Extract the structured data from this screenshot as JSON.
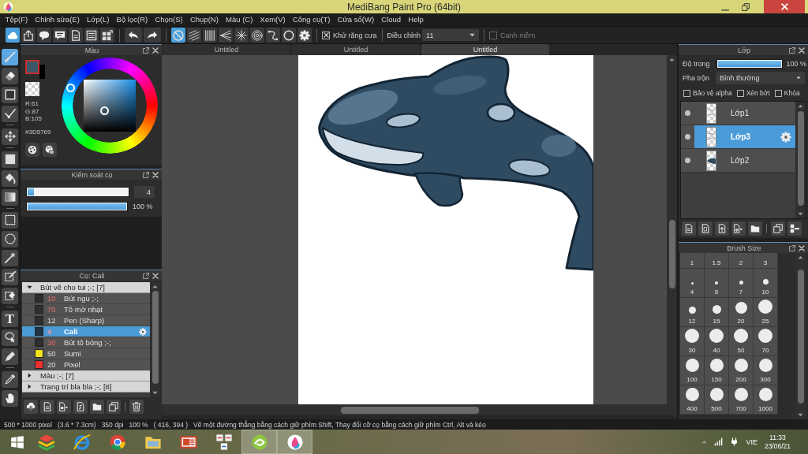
{
  "window": {
    "title": "MediBang Paint Pro (64bit)"
  },
  "menu": [
    "Tệp(F)",
    "Chỉnh sửa(E)",
    "Lớp(L)",
    "Bộ lọc(R)",
    "Chọn(S)",
    "Chụp(N)",
    "Màu (C)",
    "Xem(V)",
    "Công cụ(T)",
    "Cửa sổ(W)",
    "Cloud",
    "Help"
  ],
  "toolbar": {
    "groups": [
      {
        "buttons": [
          {
            "kind": "cloud",
            "selected": true
          },
          {
            "kind": "share",
            "selected": false
          },
          {
            "kind": "bubble",
            "selected": false
          },
          {
            "kind": "comment",
            "selected": false
          },
          {
            "kind": "document",
            "selected": false
          },
          {
            "kind": "list-document",
            "selected": false
          },
          {
            "kind": "grid-document",
            "selected": false
          }
        ]
      },
      {
        "buttons": [
          {
            "kind": "undo",
            "selected": false
          },
          {
            "kind": "redo",
            "selected": false
          }
        ]
      },
      {
        "buttons": [
          {
            "kind": "no-snap",
            "selected": true
          },
          {
            "kind": "parallel",
            "selected": false
          },
          {
            "kind": "vertical",
            "selected": false
          },
          {
            "kind": "fan",
            "selected": false
          },
          {
            "kind": "radial",
            "selected": false
          },
          {
            "kind": "concentric",
            "selected": false
          },
          {
            "kind": "curve",
            "selected": false
          },
          {
            "kind": "circle",
            "selected": false
          },
          {
            "kind": "gear",
            "selected": false
          }
        ]
      }
    ],
    "antialias": {
      "label": "Khử răng cưa",
      "checked": true,
      "disabled": false
    },
    "adjust": {
      "label": "Điều chỉnh",
      "value": "11"
    },
    "smooth_edge": {
      "label": "Canh mềm",
      "checked": false,
      "disabled": true
    }
  },
  "tools": {
    "groups": [
      {
        "tools": [
          {
            "kind": "brush",
            "selected": true
          },
          {
            "kind": "eraser",
            "selected": false
          },
          {
            "kind": "shape",
            "selected": false
          },
          {
            "kind": "vector",
            "selected": false
          }
        ]
      },
      {
        "tools": [
          {
            "kind": "move",
            "selected": false
          }
        ]
      },
      {
        "tools": [
          {
            "kind": "fill",
            "selected": false
          },
          {
            "kind": "bucket",
            "selected": false
          },
          {
            "kind": "gradient",
            "selected": false
          }
        ]
      },
      {
        "tools": [
          {
            "kind": "select",
            "selected": false
          },
          {
            "kind": "lasso",
            "selected": false
          },
          {
            "kind": "wand",
            "selected": false
          },
          {
            "kind": "select-pen",
            "selected": false
          },
          {
            "kind": "select-eraser",
            "selected": false
          }
        ]
      },
      {
        "tools": [
          {
            "kind": "text",
            "label": "T",
            "selected": false
          },
          {
            "kind": "operation",
            "selected": false
          },
          {
            "kind": "pen",
            "selected": false
          }
        ]
      },
      {
        "tools": [
          {
            "kind": "dropper",
            "selected": false
          },
          {
            "kind": "hand",
            "selected": false
          }
        ]
      }
    ]
  },
  "color_panel": {
    "title": "Màu",
    "swatches": [
      {
        "kind": "foreground",
        "color": "#3d5769"
      },
      {
        "kind": "background",
        "color": "#000000"
      }
    ],
    "channels": [
      "R:61",
      "G:87",
      "B:105"
    ],
    "hex": "#3D5769"
  },
  "brush_control": {
    "title": "Kiểm soát cọ",
    "size": {
      "level": 0.06,
      "value": "4"
    },
    "opacity": {
      "level": 1,
      "reading": "100 %"
    }
  },
  "brush_panel": {
    "title": "Cọ: Cali",
    "groups": [
      {
        "name": "Bút vẽ cho tui ;-; [7]",
        "expanded": true,
        "brushes": [
          {
            "size": "10",
            "name": "Bút ngu ;-;",
            "color": "#2e2e2e",
            "size_highlighted": true,
            "selected": false
          },
          {
            "size": "70",
            "name": "Tô mờ nhạt",
            "color": "#2e2e2e",
            "size_highlighted": true,
            "selected": false
          },
          {
            "size": "12",
            "name": "Pen (Sharp)",
            "color": "#2e2e2e",
            "size_highlighted": false,
            "selected": false
          },
          {
            "size": "4",
            "name": "Cali",
            "color": "#1f3347",
            "size_highlighted": true,
            "selected": true
          },
          {
            "size": "30",
            "name": "Bút tô bóng ;-;",
            "color": "#2e2e2e",
            "size_highlighted": true,
            "selected": false
          },
          {
            "size": "50",
            "name": "Sumi",
            "color": "#f2e21b",
            "size_highlighted": false,
            "selected": false
          },
          {
            "size": "20",
            "name": "Pixel",
            "color": "#ee3030",
            "size_highlighted": false,
            "selected": false
          }
        ]
      },
      {
        "name": "Màu ;-; [7]",
        "expanded": false
      },
      {
        "name": "Trang trí bla bla ;-; [8]",
        "expanded": false
      }
    ]
  },
  "canvas": {
    "tabs": [
      {
        "label": "Untitled",
        "selected": false
      },
      {
        "label": "Untitled",
        "selected": false
      },
      {
        "label": "Untitled",
        "selected": true
      }
    ]
  },
  "layer_panel": {
    "title": "Lớp",
    "opacity": {
      "label": "Độ trong",
      "level": 1,
      "reading": "100 %"
    },
    "blend": {
      "label": "Pha trộn",
      "value": "Bình thường"
    },
    "options": [
      {
        "label": "Bảo vệ alpha",
        "checked": false
      },
      {
        "label": "Xén bớt",
        "checked": false
      },
      {
        "label": "Khóa",
        "checked": false
      }
    ],
    "layers": [
      {
        "name": "Lớp1",
        "kind": "sketch",
        "visible": true,
        "selected": false
      },
      {
        "name": "Lớp3",
        "kind": "sketch",
        "visible": true,
        "selected": true
      },
      {
        "name": "Lớp2",
        "kind": "whale",
        "visible": true,
        "selected": false
      }
    ]
  },
  "brush_size_panel": {
    "title": "Brush Size",
    "sizes": [
      {
        "label": "1",
        "selected": false
      },
      {
        "label": "1.5",
        "selected": false
      },
      {
        "label": "2",
        "selected": false
      },
      {
        "label": "3",
        "selected": false
      },
      {
        "label": "4",
        "selected": false
      },
      {
        "label": "5",
        "selected": false
      },
      {
        "label": "7",
        "selected": false
      },
      {
        "label": "10",
        "selected": false
      },
      {
        "label": "12",
        "selected": false
      },
      {
        "label": "15",
        "selected": false
      },
      {
        "label": "20",
        "selected": false
      },
      {
        "label": "25",
        "selected": false
      },
      {
        "label": "30",
        "selected": false
      },
      {
        "label": "40",
        "selected": false
      },
      {
        "label": "50",
        "selected": false
      },
      {
        "label": "70",
        "selected": false
      },
      {
        "label": "100",
        "selected": false
      },
      {
        "label": "150",
        "selected": false
      },
      {
        "label": "200",
        "selected": false
      },
      {
        "label": "300",
        "selected": false
      },
      {
        "label": "400",
        "selected": false
      },
      {
        "label": "500",
        "selected": false
      },
      {
        "label": "700",
        "selected": false
      },
      {
        "label": "1000",
        "selected": false
      }
    ]
  },
  "status_bar": {
    "items": [
      "500 * 1000 pixel",
      "(3.6 * 7.3cm)",
      "350 dpi",
      "100 %",
      "( 416, 394 )"
    ],
    "hint": "Vẽ một đường thẳng bằng cách giữ phím Shift, Thay đổi cỡ cọ bằng cách giữ phím Ctrl, Alt và kéo"
  },
  "taskbar": {
    "apps": [
      {
        "kind": "stack",
        "active": false
      },
      {
        "kind": "e-browser",
        "active": false
      },
      {
        "kind": "ring-browser",
        "active": false
      },
      {
        "kind": "file-folder",
        "active": false
      },
      {
        "kind": "slides",
        "active": false
      },
      {
        "kind": "tiles",
        "active": false
      },
      {
        "kind": "green-app",
        "active": true
      },
      {
        "kind": "paint-app",
        "active": true
      }
    ],
    "tray": {
      "language": "VIE",
      "time": "11:33",
      "date": "23/06/21"
    }
  }
}
